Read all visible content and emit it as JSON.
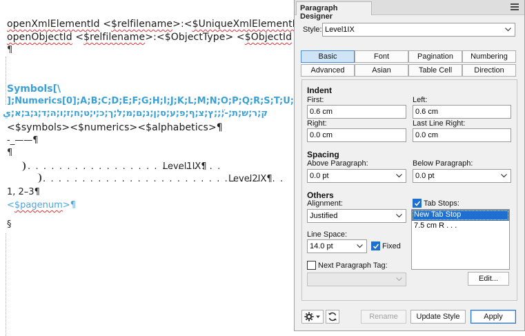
{
  "document": {
    "line1": {
      "a": "openXmlElementId",
      "b": " <",
      "c": "$relfilename",
      "d": ">:<",
      "e": "$UniqueXmlElementId"
    },
    "line2": {
      "a": "openObjectId",
      "b": " <",
      "c": "$relfilename",
      "d": ">:<",
      "e": "$ObjectType",
      "f": ">  <",
      "g": "$ObjectId"
    },
    "pilcrow": "¶",
    "symbols_line": "Symbols[\\",
    "numerics_line": "];Numerics[0];A;B;C;D;E;F;G;H;I;J;K;L;M;N;O;P;Q;R;S;T;U;",
    "hebrew_line": "ק;ר;ש;ת;-;ׂ;ׁ;ץ;צ;ף;פ;ע;ס;ן;נ;ם;מ;ל;ך;כ;י;ט;ח;ז;ו;ה;ד;ג;ב;א;ي",
    "building_blocks": "<$symbols><$numerics><$alphabetics>¶",
    "rule_line": "-_——¶",
    "level1": "Level1IX¶",
    "level2": "Level2IX¶",
    "page_range": "1, 2–3¶",
    "pagenum_a": "<",
    "pagenum_b": "$pagenum",
    "pagenum_c": ">¶",
    "section": "§"
  },
  "panel": {
    "title": "Paragraph Designer",
    "style_label": "Style:",
    "style_value": "Level1IX",
    "tabs_row1": [
      "Basic",
      "Font",
      "Pagination",
      "Numbering"
    ],
    "tabs_row2": [
      "Advanced",
      "Asian",
      "Table Cell",
      "Direction"
    ],
    "active_tab": "Basic",
    "indent": {
      "heading": "Indent",
      "first_label": "First:",
      "first_value": "0.6 cm",
      "left_label": "Left:",
      "left_value": "0.6 cm",
      "right_label": "Right:",
      "right_value": "0.0 cm",
      "last_line_right_label": "Last Line Right:",
      "last_line_right_value": "0.0 cm"
    },
    "spacing": {
      "heading": "Spacing",
      "above_label": "Above Paragraph:",
      "above_value": "0.0 pt",
      "below_label": "Below Paragraph:",
      "below_value": "0.0 pt"
    },
    "others": {
      "heading": "Others",
      "alignment_label": "Alignment:",
      "alignment_value": "Justified",
      "line_space_label": "Line Space:",
      "line_space_value": "14.0 pt",
      "fixed_label": "Fixed",
      "fixed_checked": true,
      "next_tag_label": "Next Paragraph Tag:",
      "next_tag_checked": false,
      "next_tag_value": "",
      "tab_stops_label": "Tab Stops:",
      "tab_stops_checked": true,
      "tab_stops": [
        "New Tab Stop",
        "7.5 cm  R  . . ."
      ],
      "edit_label": "Edit..."
    },
    "footer": {
      "rename_label": "Rename",
      "update_style_label": "Update Style",
      "apply_label": "Apply"
    }
  },
  "colors": {
    "accent": "#1e6fd0",
    "tab_active_bg": "#cfe5f7",
    "doc_blue": "#3aa0d8",
    "squiggle": "#e03030"
  }
}
